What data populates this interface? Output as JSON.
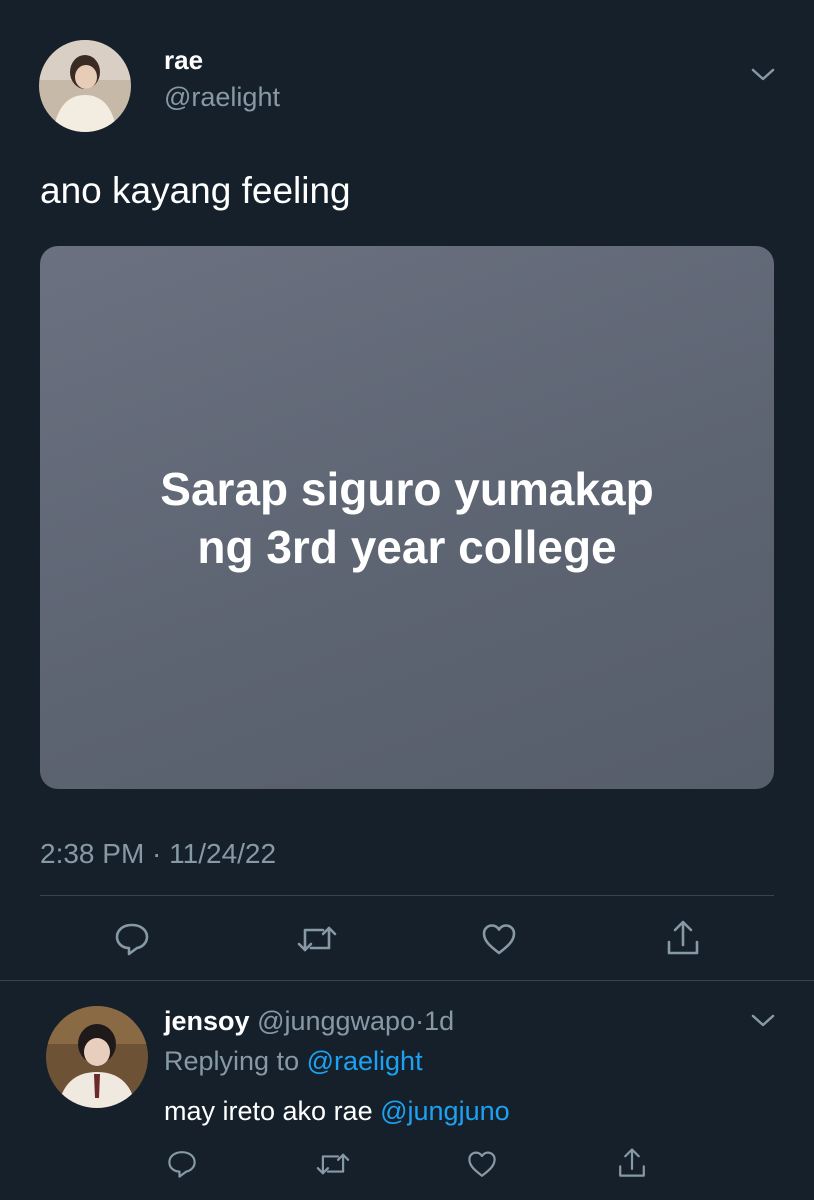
{
  "tweet": {
    "author_name": "rae",
    "author_handle": "@raelight",
    "text": "ano kayang feeling",
    "card_line1": "Sarap siguro yumakap",
    "card_line2": "ng 3rd year college",
    "timestamp": "2:38 PM · 11/24/22"
  },
  "reply": {
    "author_name": "jensoy",
    "author_handle": "@junggwapo",
    "dot": "·",
    "age": "1d",
    "replying_prefix": "Replying to",
    "replying_handle": "@raelight",
    "text_prefix": "may ireto ako rae",
    "mention": "@jungjuno"
  },
  "icons": {
    "reply": "speech-bubble-icon",
    "retweet": "retweet-arrows-icon",
    "like": "heart-icon",
    "share": "share-upload-icon",
    "menu": "chevron-down-icon"
  },
  "colors": {
    "background": "#15202b",
    "accent": "#1da1f2",
    "muted": "#8899a6",
    "card": "#5c6472"
  }
}
